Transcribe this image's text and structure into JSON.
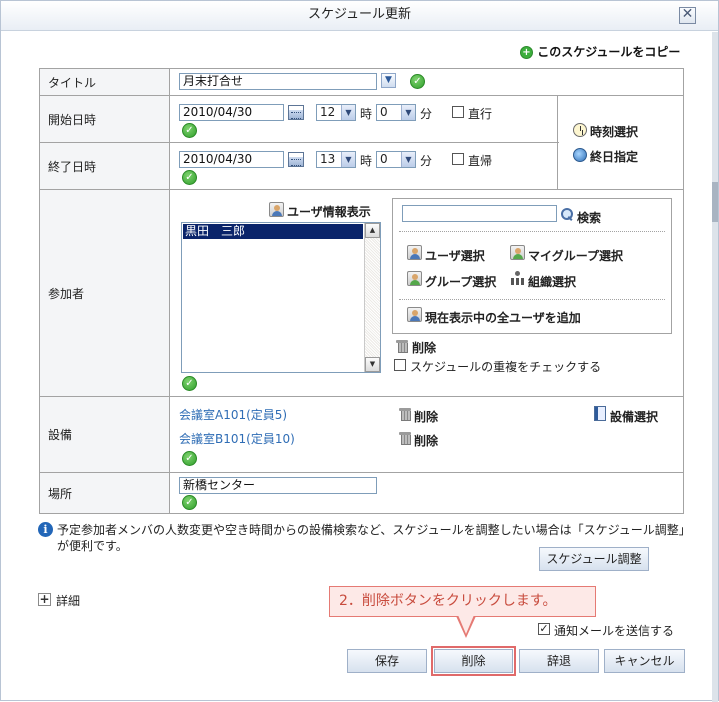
{
  "window": {
    "title": "スケジュール更新",
    "close_symbol": "✕"
  },
  "copy_link": "このスケジュールをコピー",
  "fields": {
    "title_label": "タイトル",
    "title_value": "月末打合せ",
    "start_label": "開始日時",
    "start_date": "2010/04/30",
    "start_hour": "12",
    "start_minute": "0",
    "hour_unit": "時",
    "minute_unit": "分",
    "start_direct_label": "直行",
    "end_label": "終了日時",
    "end_date": "2010/04/30",
    "end_hour": "13",
    "end_minute": "0",
    "end_direct_label": "直帰",
    "time_select": "時刻選択",
    "all_day": "終日指定"
  },
  "participants": {
    "label": "参加者",
    "user_info": "ユーザ情報表示",
    "selected_user": "黒田　三郎",
    "search_button": "検索",
    "user_select": "ユーザ選択",
    "my_group_select": "マイグループ選択",
    "group_select": "グループ選択",
    "org_select": "組織選択",
    "add_all": "現在表示中の全ユーザを追加",
    "delete": "削除",
    "dup_check_label": "スケジュールの重複をチェックする"
  },
  "facilities": {
    "label": "設備",
    "items": [
      {
        "name": "会議室A101(定員5)",
        "delete": "削除"
      },
      {
        "name": "会議室B101(定員10)",
        "delete": "削除"
      }
    ],
    "select_button": "設備選択"
  },
  "place": {
    "label": "場所",
    "value": "新橋センター"
  },
  "info_text": "予定参加者メンバの人数変更や空き時間からの設備検索など、スケジュールを調整したい場合は「スケジュール調整」が便利です。",
  "schedule_adjust": "スケジュール調整",
  "details_label": "詳細",
  "notify_label": "通知メールを送信する",
  "notify_checked": "✓",
  "callout_text": "2．削除ボタンをクリックします。",
  "buttons": {
    "save": "保存",
    "delete": "削除",
    "decline": "辞退",
    "cancel": "キャンセル"
  },
  "icons": {
    "check_symbol": "✓",
    "dropdown_symbol": "▼",
    "scroll_up": "▲",
    "scroll_down": "▼",
    "plus_symbol": "+",
    "info_symbol": "i"
  }
}
